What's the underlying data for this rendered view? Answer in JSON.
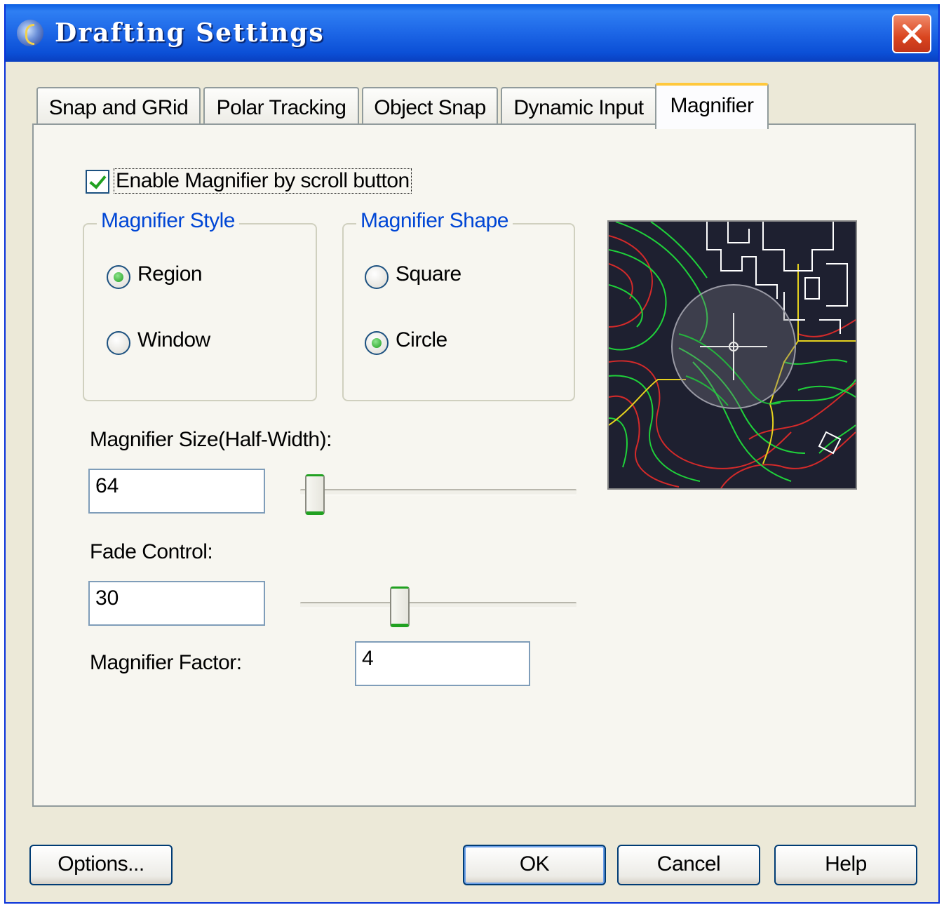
{
  "window": {
    "title": "Drafting Settings",
    "close_icon": "close-icon"
  },
  "tabs": [
    {
      "label": "Snap and GRid",
      "active": false
    },
    {
      "label": "Polar Tracking",
      "active": false
    },
    {
      "label": "Object Snap",
      "active": false
    },
    {
      "label": "Dynamic Input",
      "active": false
    },
    {
      "label": "Magnifier",
      "active": true
    }
  ],
  "magnifier": {
    "enable_label": "Enable Magnifier by scroll button",
    "enable_checked": true,
    "style": {
      "title": "Magnifier Style",
      "options": [
        {
          "label": "Region",
          "selected": true
        },
        {
          "label": "Window",
          "selected": false
        }
      ]
    },
    "shape": {
      "title": "Magnifier Shape",
      "options": [
        {
          "label": "Square",
          "selected": false
        },
        {
          "label": "Circle",
          "selected": true
        }
      ]
    },
    "size": {
      "label": "Magnifier Size(Half-Width):",
      "value": "64",
      "slider_fraction": 0.02
    },
    "fade": {
      "label": "Fade Control:",
      "value": "30",
      "slider_fraction": 0.35
    },
    "factor": {
      "label": "Magnifier Factor:",
      "value": "4"
    }
  },
  "buttons": {
    "options": "Options...",
    "ok": "OK",
    "cancel": "Cancel",
    "help": "Help"
  },
  "colors": {
    "title_bar": "#1d66e6",
    "dialog_bg": "#ece9d8",
    "group_title": "#0046d5",
    "contour_red": "#d42a2a",
    "contour_green": "#1fd13a",
    "contour_yellow": "#e6d21e"
  }
}
